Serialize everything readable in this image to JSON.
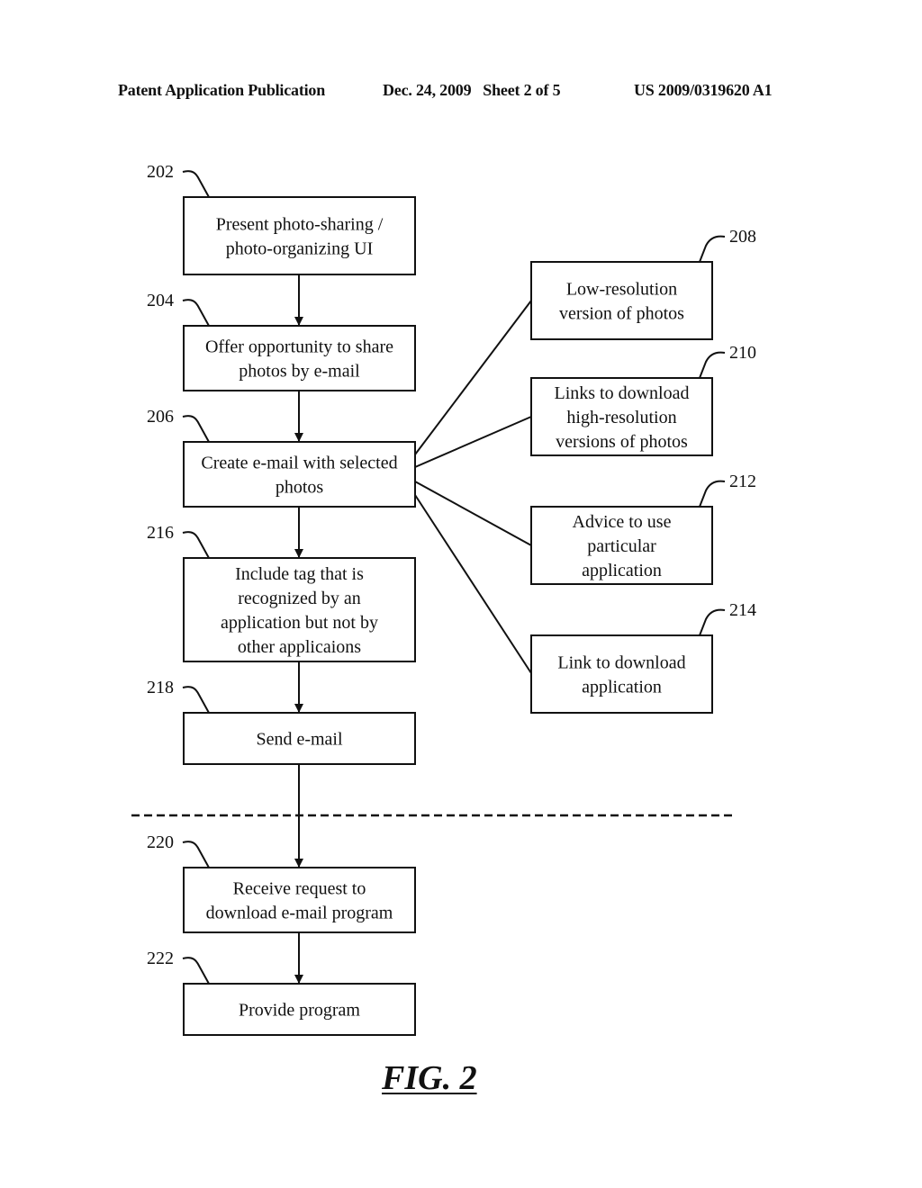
{
  "header": {
    "publication": "Patent Application Publication",
    "date_sheet": "Dec. 24, 2009   Sheet 2 of 5",
    "number": "US 2009/0319620 A1"
  },
  "flow": {
    "steps": [
      {
        "ref": "202",
        "lines": [
          "Present photo-sharing /",
          "photo-organizing UI"
        ]
      },
      {
        "ref": "204",
        "lines": [
          "Offer opportunity to share",
          "photos by e-mail"
        ]
      },
      {
        "ref": "206",
        "lines": [
          "Create e-mail with selected",
          "photos"
        ]
      },
      {
        "ref": "216",
        "lines": [
          "Include tag that is",
          "recognized by an",
          "application but not by",
          "other applicaions"
        ]
      },
      {
        "ref": "218",
        "lines": [
          "Send e-mail"
        ]
      },
      {
        "ref": "220",
        "lines": [
          "Receive request to",
          "download e-mail program"
        ]
      },
      {
        "ref": "222",
        "lines": [
          "Provide program"
        ]
      }
    ],
    "components": [
      {
        "ref": "208",
        "lines": [
          "Low-resolution",
          "version of photos"
        ]
      },
      {
        "ref": "210",
        "lines": [
          "Links to download",
          "high-resolution",
          "versions of photos"
        ]
      },
      {
        "ref": "212",
        "lines": [
          "Advice to use",
          "particular",
          "application"
        ]
      },
      {
        "ref": "214",
        "lines": [
          "Link to download",
          "application"
        ]
      }
    ]
  },
  "figure_label": "FIG. 2"
}
